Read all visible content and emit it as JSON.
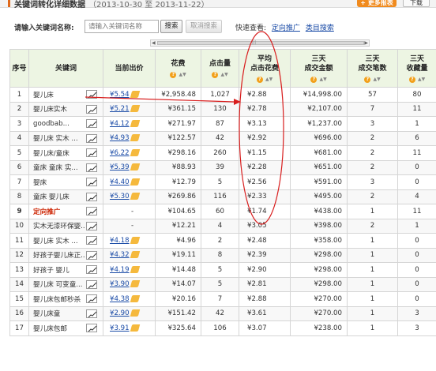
{
  "header": {
    "title": "关键词转化详细数据",
    "date_range": "（2013-10-30 至 2013-11-22）",
    "more_button": "更多报表",
    "download_button": "下载"
  },
  "search": {
    "label": "请输入关键词名称:",
    "placeholder": "请输入关键词名称",
    "search_button": "搜索",
    "cancel_button": "取消搜索",
    "quick_label": "快速查看:",
    "quick_links": [
      "定向推广",
      "类目搜索"
    ]
  },
  "table": {
    "columns": [
      "序号",
      "关键词",
      "当前出价",
      "花费",
      "点击量",
      "平均\n点击花费",
      "三天\n成交金额",
      "三天\n成交笔数",
      "三天\n收藏量"
    ],
    "rows": [
      {
        "idx": "1",
        "kw": "婴儿床",
        "bid": "¥5.54",
        "cost": "¥2,958.48",
        "clicks": "1,027",
        "cpc": "¥2.88",
        "amount": "¥14,998.00",
        "orders": "57",
        "favs": "80"
      },
      {
        "idx": "2",
        "kw": "婴儿床实木",
        "bid": "¥5.21",
        "cost": "¥361.15",
        "clicks": "130",
        "cpc": "¥2.78",
        "amount": "¥2,107.00",
        "orders": "7",
        "favs": "11"
      },
      {
        "idx": "3",
        "kw": "goodbab...",
        "bid": "¥4.12",
        "cost": "¥271.97",
        "clicks": "87",
        "cpc": "¥3.13",
        "amount": "¥1,237.00",
        "orders": "3",
        "favs": "1"
      },
      {
        "idx": "4",
        "kw": "婴儿床 实木 ...",
        "bid": "¥4.93",
        "cost": "¥122.57",
        "clicks": "42",
        "cpc": "¥2.92",
        "amount": "¥696.00",
        "orders": "2",
        "favs": "6"
      },
      {
        "idx": "5",
        "kw": "婴儿床/童床",
        "bid": "¥6.22",
        "cost": "¥298.16",
        "clicks": "260",
        "cpc": "¥1.15",
        "amount": "¥681.00",
        "orders": "2",
        "favs": "11"
      },
      {
        "idx": "6",
        "kw": "童床 童床 实...",
        "bid": "¥5.39",
        "cost": "¥88.93",
        "clicks": "39",
        "cpc": "¥2.28",
        "amount": "¥651.00",
        "orders": "2",
        "favs": "0"
      },
      {
        "idx": "7",
        "kw": "婴床",
        "bid": "¥4.40",
        "cost": "¥12.79",
        "clicks": "5",
        "cpc": "¥2.56",
        "amount": "¥591.00",
        "orders": "3",
        "favs": "0"
      },
      {
        "idx": "8",
        "kw": "童床 婴儿床",
        "bid": "¥5.30",
        "cost": "¥269.86",
        "clicks": "116",
        "cpc": "¥2.33",
        "amount": "¥495.00",
        "orders": "2",
        "favs": "4"
      },
      {
        "idx": "9",
        "kw": "定向推广",
        "bid": "-",
        "cost": "¥104.65",
        "clicks": "60",
        "cpc": "¥1.74",
        "amount": "¥438.00",
        "orders": "1",
        "favs": "11",
        "highlight": true
      },
      {
        "idx": "10",
        "kw": "实木无漆环保婴...",
        "bid": "-",
        "cost": "¥12.21",
        "clicks": "4",
        "cpc": "¥3.05",
        "amount": "¥398.00",
        "orders": "2",
        "favs": "1"
      },
      {
        "idx": "11",
        "kw": "婴儿床 实木 ...",
        "bid": "¥4.18",
        "cost": "¥4.96",
        "clicks": "2",
        "cpc": "¥2.48",
        "amount": "¥358.00",
        "orders": "1",
        "favs": "0"
      },
      {
        "idx": "12",
        "kw": "好孩子婴儿床正...",
        "bid": "¥4.32",
        "cost": "¥19.11",
        "clicks": "8",
        "cpc": "¥2.39",
        "amount": "¥298.00",
        "orders": "1",
        "favs": "0"
      },
      {
        "idx": "13",
        "kw": "好孩子 婴儿",
        "bid": "¥4.19",
        "cost": "¥14.48",
        "clicks": "5",
        "cpc": "¥2.90",
        "amount": "¥298.00",
        "orders": "1",
        "favs": "0"
      },
      {
        "idx": "14",
        "kw": "婴儿床 可变童...",
        "bid": "¥3.90",
        "cost": "¥14.07",
        "clicks": "5",
        "cpc": "¥2.81",
        "amount": "¥298.00",
        "orders": "1",
        "favs": "0"
      },
      {
        "idx": "15",
        "kw": "婴儿床包邮秒杀",
        "bid": "¥4.38",
        "cost": "¥20.16",
        "clicks": "7",
        "cpc": "¥2.88",
        "amount": "¥270.00",
        "orders": "1",
        "favs": "0"
      },
      {
        "idx": "16",
        "kw": "婴儿床童",
        "bid": "¥2.90",
        "cost": "¥151.42",
        "clicks": "42",
        "cpc": "¥3.61",
        "amount": "¥270.00",
        "orders": "1",
        "favs": "3"
      },
      {
        "idx": "17",
        "kw": "婴儿床包邮",
        "bid": "¥3.91",
        "cost": "¥325.64",
        "clicks": "106",
        "cpc": "¥3.07",
        "amount": "¥238.00",
        "orders": "1",
        "favs": "3"
      }
    ]
  },
  "colors": {
    "header_bg": "#edf5e3",
    "accent_orange": "#f08a1d",
    "link_blue": "#1a4ba6",
    "annotation_red": "#d81e1e"
  }
}
